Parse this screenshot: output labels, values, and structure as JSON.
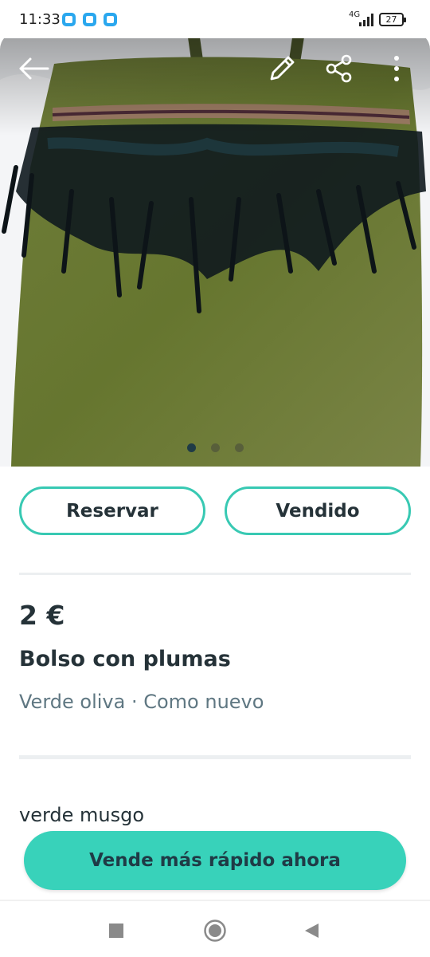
{
  "status_bar": {
    "time": "11:33",
    "network": "4G",
    "battery": "27",
    "app_icons": [
      "app-notification-icon",
      "app-notification-icon",
      "app-notification-icon"
    ]
  },
  "hero": {
    "image_subject": "green knitted bag with black feathers",
    "slide_count": 3,
    "active_slide": 1,
    "icons": [
      "back-arrow-icon",
      "edit-pencil-icon",
      "share-icon",
      "more-vert-icon"
    ]
  },
  "actions": {
    "reserve_label": "Reservar",
    "sold_label": "Vendido"
  },
  "listing": {
    "price": "2 €",
    "title": "Bolso con plumas",
    "color": "Verde oliva",
    "separator": " · ",
    "condition": "Como nuevo",
    "description": "verde musgo"
  },
  "cta": {
    "label": "Vende más rápido ahora"
  },
  "nav": {
    "icons": [
      "recents-square-icon",
      "home-circle-icon",
      "back-triangle-icon"
    ]
  },
  "colors": {
    "accent": "#38d2ba",
    "outline": "#38c9b3",
    "text_primary": "#253238",
    "text_secondary": "#5f7782"
  }
}
